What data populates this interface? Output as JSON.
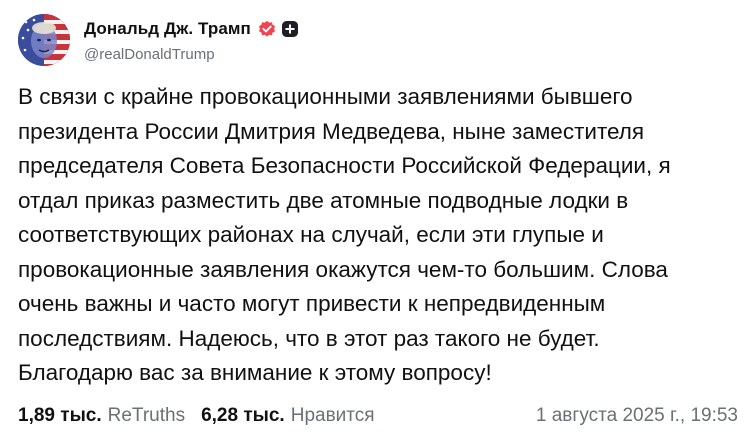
{
  "post": {
    "author": {
      "display_name": "Дональд Дж. Трамп",
      "handle": "@realDonaldTrump",
      "verified_icon": "verified-badge-icon",
      "extra_badge_icon": "plus-badge-icon"
    },
    "text": "В связи с крайне провокационными заявлениями бывшего\nпрезидента России Дмитрия Медведева, ныне заместителя\nпредседателя Совета Безопасности Российской Федерации, я\nотдал приказ разместить две атомные подводные лодки в\nсоответствующих районах на случай, если эти глупые и\nпровокационные заявления окажутся чем-то большим. Слова\nочень важны и часто могут привести к непредвиденным\nпоследствиям. Надеюсь, что в этот раз такого не будет.\nБлагодарю вас за внимание к этому вопросу!",
    "stats": {
      "retruths_count": "1,89 тыс.",
      "retruths_label": "ReTruths",
      "likes_count": "6,28 тыс.",
      "likes_label": "Нравится"
    },
    "timestamp": "1 августа 2025 г., 19:53"
  },
  "colors": {
    "text": "#111111",
    "muted": "#6b6f76",
    "verified_badge": "#f04452"
  }
}
